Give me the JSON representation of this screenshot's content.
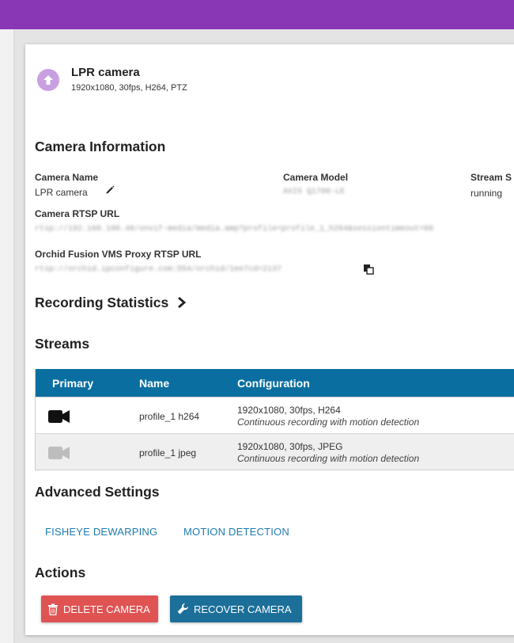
{
  "camera": {
    "title": "LPR camera",
    "subtitle": "1920x1080, 30fps, H264, PTZ",
    "icon": "upload-circle-icon"
  },
  "sections": {
    "camera_info": "Camera Information",
    "recording_stats": "Recording Statistics",
    "streams": "Streams",
    "advanced": "Advanced Settings",
    "actions": "Actions"
  },
  "info": {
    "name_label": "Camera Name",
    "name_value": "LPR camera",
    "model_label": "Camera Model",
    "model_value": "AXIS Q1700-LE",
    "stream_label": "Stream S",
    "stream_value": "running",
    "rtsp_label": "Camera RTSP URL",
    "rtsp_value": "rtsp://192.168.100.46/onvif-media/media.amp?profile=profile_1_h264&sessiontimeout=60",
    "proxy_label": "Orchid Fusion VMS Proxy RTSP URL",
    "proxy_value": "rtsp://orchid.ipconfigure.com:554/orchid/1ee7cd=2137"
  },
  "streams_table": {
    "headers": [
      "Primary",
      "Name",
      "Configuration"
    ],
    "rows": [
      {
        "primary": true,
        "name": "profile_1 h264",
        "config": "1920x1080, 30fps, H264",
        "mode": "Continuous recording with motion detection"
      },
      {
        "primary": false,
        "name": "profile_1 jpeg",
        "config": "1920x1080, 30fps, JPEG",
        "mode": "Continuous recording with motion detection"
      }
    ]
  },
  "advanced_links": [
    "FISHEYE DEWARPING",
    "MOTION DETECTION"
  ],
  "buttons": {
    "delete": "DELETE CAMERA",
    "recover": "RECOVER CAMERA"
  },
  "colors": {
    "topbar": "#8a37b6",
    "table_header": "#0a6fa0",
    "delete": "#e05353",
    "recover": "#1b6f99",
    "link": "#1e7bb0"
  }
}
